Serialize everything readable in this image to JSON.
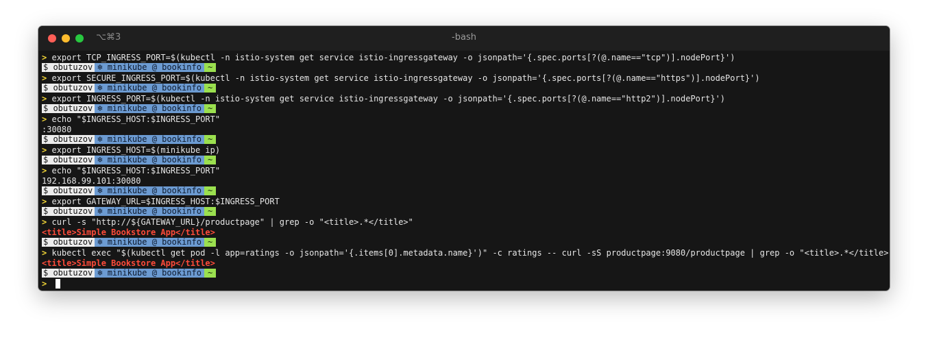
{
  "window": {
    "shortcut": "⌥⌘3",
    "title": "-bash"
  },
  "prompt": {
    "arrow": ">",
    "user": "$ obutuzov",
    "context": "❄ minikube @ bookinfo",
    "dir": "~"
  },
  "lines": [
    {
      "type": "cmd",
      "text": "export TCP_INGRESS_PORT=$(kubectl -n istio-system get service istio-ingressgateway -o jsonpath='{.spec.ports[?(@.name==\"tcp\")].nodePort}')"
    },
    {
      "type": "status"
    },
    {
      "type": "cmd",
      "text": "export SECURE_INGRESS_PORT=$(kubectl -n istio-system get service istio-ingressgateway -o jsonpath='{.spec.ports[?(@.name==\"https\")].nodePort}')"
    },
    {
      "type": "status"
    },
    {
      "type": "cmd",
      "text": "export INGRESS_PORT=$(kubectl -n istio-system get service istio-ingressgateway -o jsonpath='{.spec.ports[?(@.name==\"http2\")].nodePort}')"
    },
    {
      "type": "status"
    },
    {
      "type": "cmd",
      "text": "echo \"$INGRESS_HOST:$INGRESS_PORT\""
    },
    {
      "type": "output",
      "text": ":30080"
    },
    {
      "type": "status"
    },
    {
      "type": "cmd",
      "text": "export INGRESS_HOST=$(minikube ip)"
    },
    {
      "type": "status"
    },
    {
      "type": "cmd",
      "text": "echo \"$INGRESS_HOST:$INGRESS_PORT\""
    },
    {
      "type": "output",
      "text": "192.168.99.101:30080"
    },
    {
      "type": "status"
    },
    {
      "type": "cmd",
      "text": "export GATEWAY_URL=$INGRESS_HOST:$INGRESS_PORT"
    },
    {
      "type": "status"
    },
    {
      "type": "cmd",
      "text": "curl -s \"http://${GATEWAY_URL}/productpage\" | grep -o \"<title>.*</title>\""
    },
    {
      "type": "output-red",
      "text": "<title>Simple Bookstore App</title>"
    },
    {
      "type": "status"
    },
    {
      "type": "cmd",
      "text": "kubectl exec \"$(kubectl get pod -l app=ratings -o jsonpath='{.items[0].metadata.name}')\" -c ratings -- curl -sS productpage:9080/productpage | grep -o \"<title>.*</title>\""
    },
    {
      "type": "output-red",
      "text": "<title>Simple Bookstore App</title>"
    },
    {
      "type": "status"
    },
    {
      "type": "input",
      "text": ""
    }
  ]
}
